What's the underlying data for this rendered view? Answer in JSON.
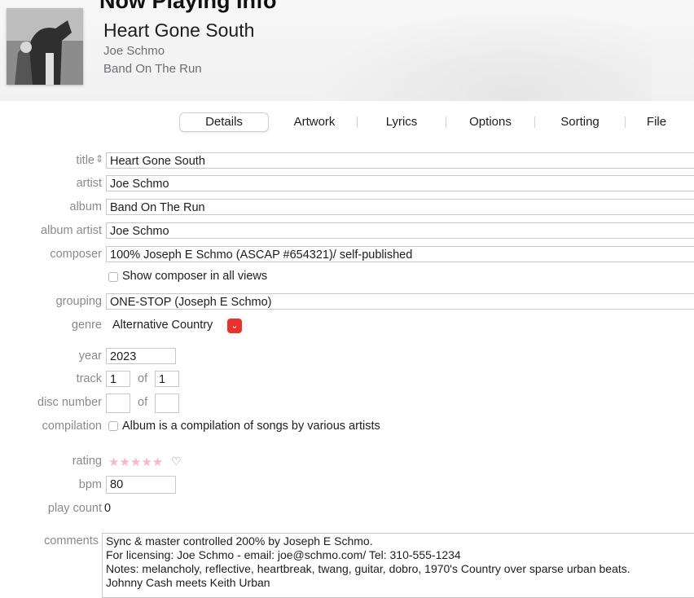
{
  "header": {
    "cropped_heading": "Now Playing Info",
    "title": "Heart Gone South",
    "artist": "Joe Schmo",
    "album": "Band On The Run",
    "artwork_icon": "album-artwork"
  },
  "tabs": [
    {
      "label": "Details",
      "active": true
    },
    {
      "label": "Artwork",
      "active": false
    },
    {
      "label": "Lyrics",
      "active": false
    },
    {
      "label": "Options",
      "active": false
    },
    {
      "label": "Sorting",
      "active": false
    },
    {
      "label": "File",
      "active": false
    }
  ],
  "labels": {
    "title": "title",
    "sort_icon": "⇕",
    "artist": "artist",
    "album": "album",
    "album_artist": "album artist",
    "composer": "composer",
    "grouping": "grouping",
    "genre": "genre",
    "year": "year",
    "track": "track",
    "disc_number": "disc number",
    "compilation": "compilation",
    "rating": "rating",
    "bpm": "bpm",
    "play_count": "play count",
    "comments": "comments",
    "of": "of"
  },
  "fields": {
    "title": "Heart Gone South",
    "artist": "Joe Schmo",
    "album": "Band On The Run",
    "album_artist": "Joe Schmo",
    "composer": "100% Joseph E Schmo (ASCAP #654321)/ self-published",
    "show_composer_label": "Show composer in all views",
    "show_composer_checked": false,
    "grouping": "ONE-STOP (Joseph E Schmo)",
    "genre": "Alternative Country",
    "genre_arrow_icon": "chevron-down-icon",
    "year": "2023",
    "track": "1",
    "track_of": "1",
    "disc": "",
    "disc_of": "",
    "compilation_label": "Album is a compilation of songs by various artists",
    "compilation_checked": false,
    "rating_stars": "★★★★★",
    "rating_value": 0,
    "heart": "♡",
    "bpm": "80",
    "play_count": "0",
    "comments": [
      "Sync & master controlled 200% by Joseph E Schmo.",
      "For licensing: Joe Schmo - email: joe@schmo.com/ Tel: 310-555-1234",
      "Notes: melancholy, reflective, heartbreak, twang, guitar, dobro, 1970's Country over sparse urban beats.",
      "Johnny Cash meets Keith Urban"
    ]
  },
  "colors": {
    "accent_red": "#e8322e",
    "label_gray": "#8a8a8e",
    "star_pink": "#f7b8c0"
  }
}
